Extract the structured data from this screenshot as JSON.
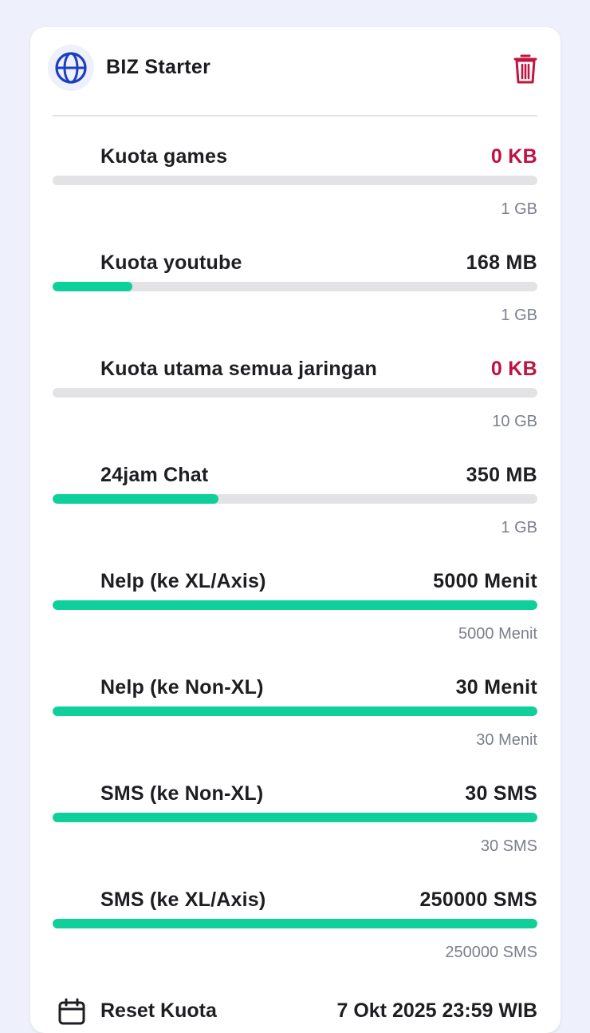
{
  "package": {
    "icon": "globe-icon",
    "title": "BIZ Starter",
    "delete_icon": "trash-icon"
  },
  "quotas": [
    {
      "name": "Kuota games",
      "remaining": "0 KB",
      "total": "1 GB",
      "fraction": 0,
      "zero": true
    },
    {
      "name": "Kuota youtube",
      "remaining": "168 MB",
      "total": "1 GB",
      "fraction": 0.164,
      "zero": false
    },
    {
      "name": "Kuota utama semua jaringan",
      "remaining": "0 KB",
      "total": "10 GB",
      "fraction": 0,
      "zero": true
    },
    {
      "name": "24jam Chat",
      "remaining": "350 MB",
      "total": "1 GB",
      "fraction": 0.342,
      "zero": false
    },
    {
      "name": "Nelp (ke XL/Axis)",
      "remaining": "5000 Menit",
      "total": "5000 Menit",
      "fraction": 1,
      "zero": false
    },
    {
      "name": "Nelp (ke Non-XL)",
      "remaining": "30 Menit",
      "total": "30 Menit",
      "fraction": 1,
      "zero": false
    },
    {
      "name": "SMS (ke Non-XL)",
      "remaining": "30 SMS",
      "total": "30 SMS",
      "fraction": 1,
      "zero": false
    },
    {
      "name": "SMS (ke XL/Axis)",
      "remaining": "250000 SMS",
      "total": "250000 SMS",
      "fraction": 1,
      "zero": false
    }
  ],
  "reset": {
    "icon": "calendar-icon",
    "label": "Reset Kuota",
    "date": "7 Okt 2025 23:59 WIB"
  },
  "colors": {
    "accent_fill": "#0fd09a",
    "zero_value": "#bf1142",
    "brand_blue": "#1a3fbf"
  }
}
